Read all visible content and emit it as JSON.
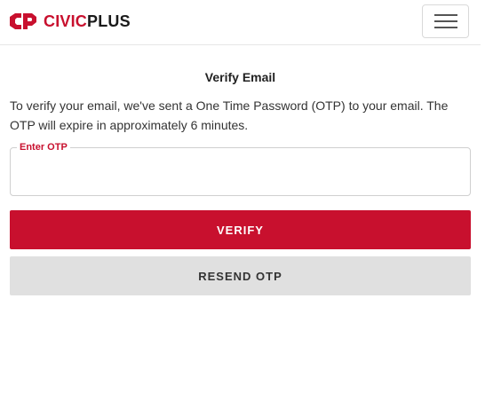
{
  "header": {
    "logo_civic": "CIVIC",
    "logo_plus": "PLUS",
    "brand_color": "#c8102e",
    "menu_icon": "hamburger-menu-icon"
  },
  "main": {
    "title": "Verify Email",
    "description": "To verify your email, we've sent a One Time Password (OTP) to your email. The OTP will expire in approximately 6 minutes.",
    "otp_field": {
      "label": "Enter OTP",
      "value": "",
      "placeholder": ""
    },
    "verify_button": "VERIFY",
    "resend_button": "RESEND OTP"
  },
  "colors": {
    "accent": "#c8102e",
    "secondary_button": "#e0e0e0"
  }
}
